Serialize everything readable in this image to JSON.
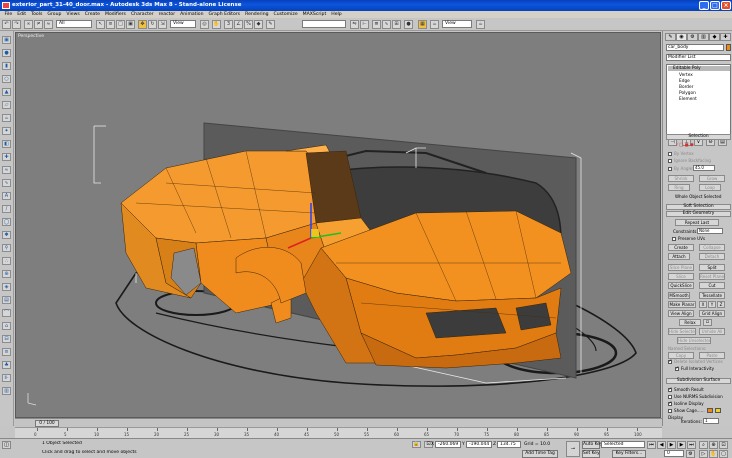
{
  "window": {
    "title": "exterior_part_31-40_door.max - Autodesk 3ds Max 8 - Stand-alone License",
    "min": "_",
    "max": "□",
    "close": "×"
  },
  "menu": [
    "File",
    "Edit",
    "Tools",
    "Group",
    "Views",
    "Create",
    "Modifiers",
    "Character",
    "reactor",
    "Animation",
    "Graph Editors",
    "Rendering",
    "Customize",
    "MAXScript",
    "Help"
  ],
  "toolbar": {
    "filter_value": "All",
    "refcoord_value": "View",
    "named_sel_value": "",
    "view_value": "View"
  },
  "viewport": {
    "label": "Perspective",
    "background": "#7e7e7e",
    "model_color": "#f08c1e"
  },
  "command_panel": {
    "tabs": [
      "✎",
      "◉",
      "⚙",
      "▥",
      "◆",
      "✚"
    ],
    "object_name": "car_body",
    "modifier_list": "Modifier List",
    "stack": [
      "Editable Poly",
      "Vertex",
      "Edge",
      "Border",
      "Polygon",
      "Element"
    ],
    "selection": {
      "title": "Selection",
      "by_vertex": "By Vertex",
      "ignore_backfacing": "Ignore Backfacing",
      "by_angle": "By Angle:",
      "angle_value": "45.0",
      "shrink": "Shrink",
      "grow": "Grow",
      "ring": "Ring",
      "loop": "Loop",
      "status": "Whole Object Selected"
    },
    "soft_selection": "Soft Selection",
    "edit_geometry": {
      "title": "Edit Geometry",
      "repeat_last": "Repeat Last",
      "constraints": "Constraints:",
      "constraints_value": "None",
      "preserve_uvs": "Preserve UVs",
      "create": "Create",
      "collapse": "Collapse",
      "attach": "Attach",
      "detach": "Detach",
      "slice_plane": "Slice Plane",
      "split": "Split",
      "slice": "Slice",
      "reset_plane": "Reset Plane",
      "quickslice": "QuickSlice",
      "cut": "Cut",
      "msmooth": "MSmooth",
      "tessellate": "Tessellate",
      "make_planar": "Make Planar",
      "x": "X",
      "y": "Y",
      "z": "Z",
      "view_align": "View Align",
      "grid_align": "Grid Align",
      "relax": "Relax",
      "hide_selected": "Hide Selected",
      "unhide_all": "Unhide All",
      "hide_unselected": "Hide Unselected",
      "named_selections": "Named Selections:",
      "copy": "Copy",
      "paste": "Paste",
      "delete_isolated": "Delete Isolated Vertices",
      "full_interactivity": "Full Interactivity"
    },
    "subdivision": {
      "title": "Subdivision Surface",
      "smooth_result": "Smooth Result",
      "use_nurms": "Use NURMS Subdivision",
      "isoline": "Isoline Display",
      "show_cage": "Show Cage......",
      "cage_color1": "#f08a10",
      "cage_color2": "#f0d020",
      "display": "Display",
      "iterations": "Iterations:",
      "iterations_value": "1",
      "smoothness": "Smoothness:",
      "smoothness_value": "1.0"
    }
  },
  "timeline": {
    "slider_label": "0 / 100",
    "ticks": [
      "0",
      "5",
      "10",
      "15",
      "20",
      "25",
      "30",
      "35",
      "40",
      "45",
      "50",
      "55",
      "60",
      "65",
      "70",
      "75",
      "80",
      "85",
      "90",
      "95",
      "100"
    ]
  },
  "status": {
    "selection": "1 Object Selected",
    "prompt": "Click and drag to select and move objects",
    "x_label": "X",
    "x_value": "-260.069",
    "y_label": "Y",
    "y_value": "-190.044",
    "z_label": "Z",
    "z_value": "134.75",
    "grid": "Grid = 10.0",
    "add_time_tag": "Add Time Tag",
    "auto_key": "Auto Key",
    "set_key": "Set Key",
    "key_mode_value": "Selected",
    "key_filters": "Key Filters...",
    "frame_value": "0"
  }
}
